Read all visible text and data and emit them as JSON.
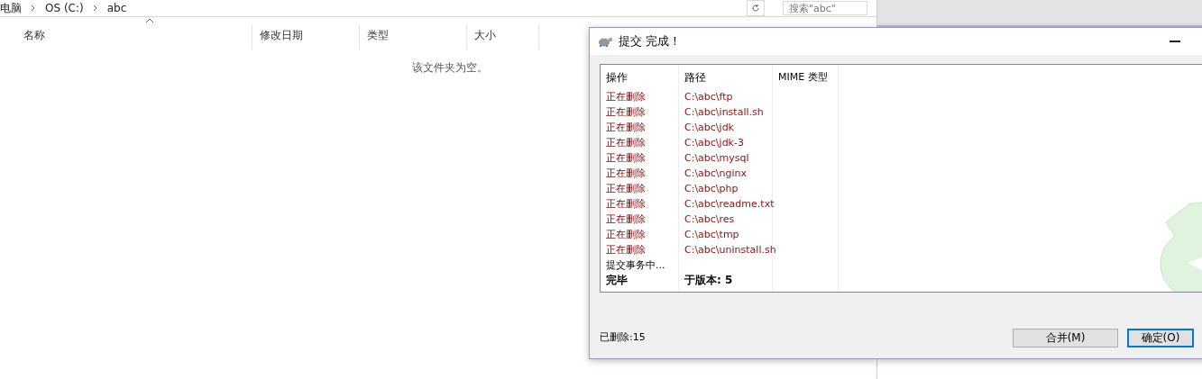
{
  "explorer": {
    "breadcrumb": [
      "电脑",
      "OS (C:)",
      "abc"
    ],
    "search": {
      "placeholder": "搜索\"abc\""
    },
    "columns": [
      "名称",
      "修改日期",
      "类型",
      "大小"
    ],
    "empty_text": "该文件夹为空。"
  },
  "dialog": {
    "title": "提交 完成！",
    "columns": [
      "操作",
      "路径",
      "MIME 类型"
    ],
    "rows": [
      {
        "kind": "deleting",
        "action": "正在删除",
        "path": "C:\\abc\\ftp"
      },
      {
        "kind": "deleting",
        "action": "正在删除",
        "path": "C:\\abc\\install.sh"
      },
      {
        "kind": "deleting",
        "action": "正在删除",
        "path": "C:\\abc\\jdk"
      },
      {
        "kind": "deleting",
        "action": "正在删除",
        "path": "C:\\abc\\jdk-3"
      },
      {
        "kind": "deleting",
        "action": "正在删除",
        "path": "C:\\abc\\mysql"
      },
      {
        "kind": "deleting",
        "action": "正在删除",
        "path": "C:\\abc\\nginx"
      },
      {
        "kind": "deleting",
        "action": "正在删除",
        "path": "C:\\abc\\php"
      },
      {
        "kind": "deleting",
        "action": "正在删除",
        "path": "C:\\abc\\readme.txt"
      },
      {
        "kind": "deleting",
        "action": "正在删除",
        "path": "C:\\abc\\res"
      },
      {
        "kind": "deleting",
        "action": "正在删除",
        "path": "C:\\abc\\tmp"
      },
      {
        "kind": "deleting",
        "action": "正在删除",
        "path": "C:\\abc\\uninstall.sh"
      },
      {
        "kind": "info",
        "action": "提交事务中..."
      },
      {
        "kind": "done",
        "action": "完毕",
        "path": "于版本: 5"
      }
    ],
    "status": "已删除:15",
    "buttons": [
      {
        "label": "合并(M)",
        "default": false
      },
      {
        "label": "确定(O)",
        "default": true
      }
    ]
  }
}
